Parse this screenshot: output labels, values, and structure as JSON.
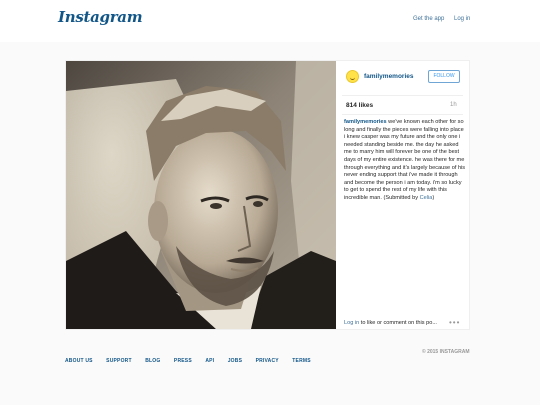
{
  "header": {
    "logo_text": "Instagram",
    "get_app_label": "Get the app",
    "login_label": "Log in"
  },
  "post": {
    "username": "familymemories",
    "follow_label": "FOLLOW",
    "likes": "814 likes",
    "time": "1h",
    "caption_user": "familymemories",
    "caption_text": "we've known each other for so long and finally the pieces were falling into place i knew casper was my future and the only one i needed standing beside me. the day he asked me to marry him will forever be one of the best days of my entire existence. he was there for me through everything and it's largely because of his never ending support that i've made it through and become the person i am today. i'm so lucky to get to spend the rest of my life with this incredible man.",
    "caption_submitted_prefix": " (Submitted by ",
    "caption_submitted_name": "Celia",
    "caption_submitted_suffix": ")",
    "comment_login": "Log in",
    "comment_rest": " to like or comment on this po...",
    "more_label": "•••"
  },
  "footer": {
    "links": [
      "ABOUT US",
      "SUPPORT",
      "BLOG",
      "PRESS",
      "API",
      "JOBS",
      "PRIVACY",
      "TERMS"
    ],
    "copyright": "© 2015 INSTAGRAM"
  },
  "colors": {
    "brand_blue": "#125688",
    "link_blue": "#3f729b",
    "follow_blue": "#3897f0"
  }
}
